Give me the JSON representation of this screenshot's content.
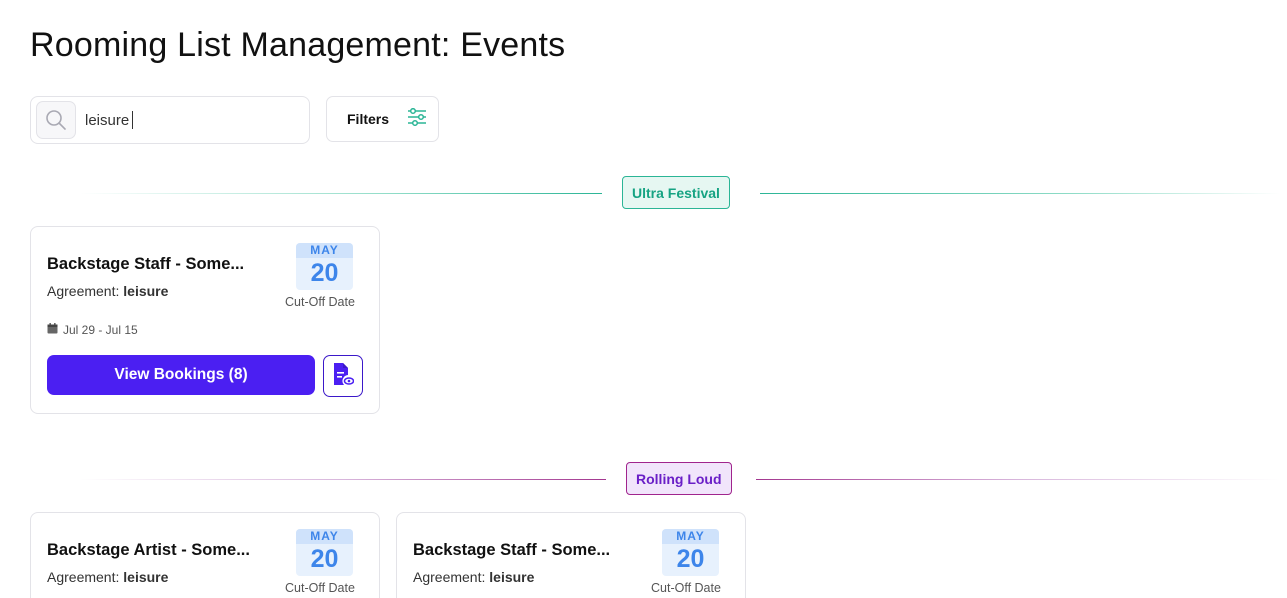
{
  "page": {
    "title": "Rooming List Management: Events"
  },
  "search": {
    "value": "leisure"
  },
  "filters": {
    "label": "Filters"
  },
  "colors": {
    "accent": "#4b1ff2",
    "ultra": "#2bb596",
    "rolling": "#a0248d",
    "date_blue": "#3d85ea"
  },
  "groups": [
    {
      "name": "Ultra Festival",
      "cards": [
        {
          "title": "Backstage Staff - Some...",
          "agreement_label": "Agreement:",
          "agreement_value": "leisure",
          "month": "MAY",
          "day": "20",
          "cutoff_label": "Cut-Off Date",
          "date_range": "Jul 29 - Jul 15",
          "button_label": "View Bookings (8)"
        }
      ]
    },
    {
      "name": "Rolling Loud",
      "cards": [
        {
          "title": "Backstage Artist - Some...",
          "agreement_label": "Agreement:",
          "agreement_value": "leisure",
          "month": "MAY",
          "day": "20",
          "cutoff_label": "Cut-Off Date"
        },
        {
          "title": "Backstage Staff - Some...",
          "agreement_label": "Agreement:",
          "agreement_value": "leisure",
          "month": "MAY",
          "day": "20",
          "cutoff_label": "Cut-Off Date"
        }
      ]
    }
  ]
}
